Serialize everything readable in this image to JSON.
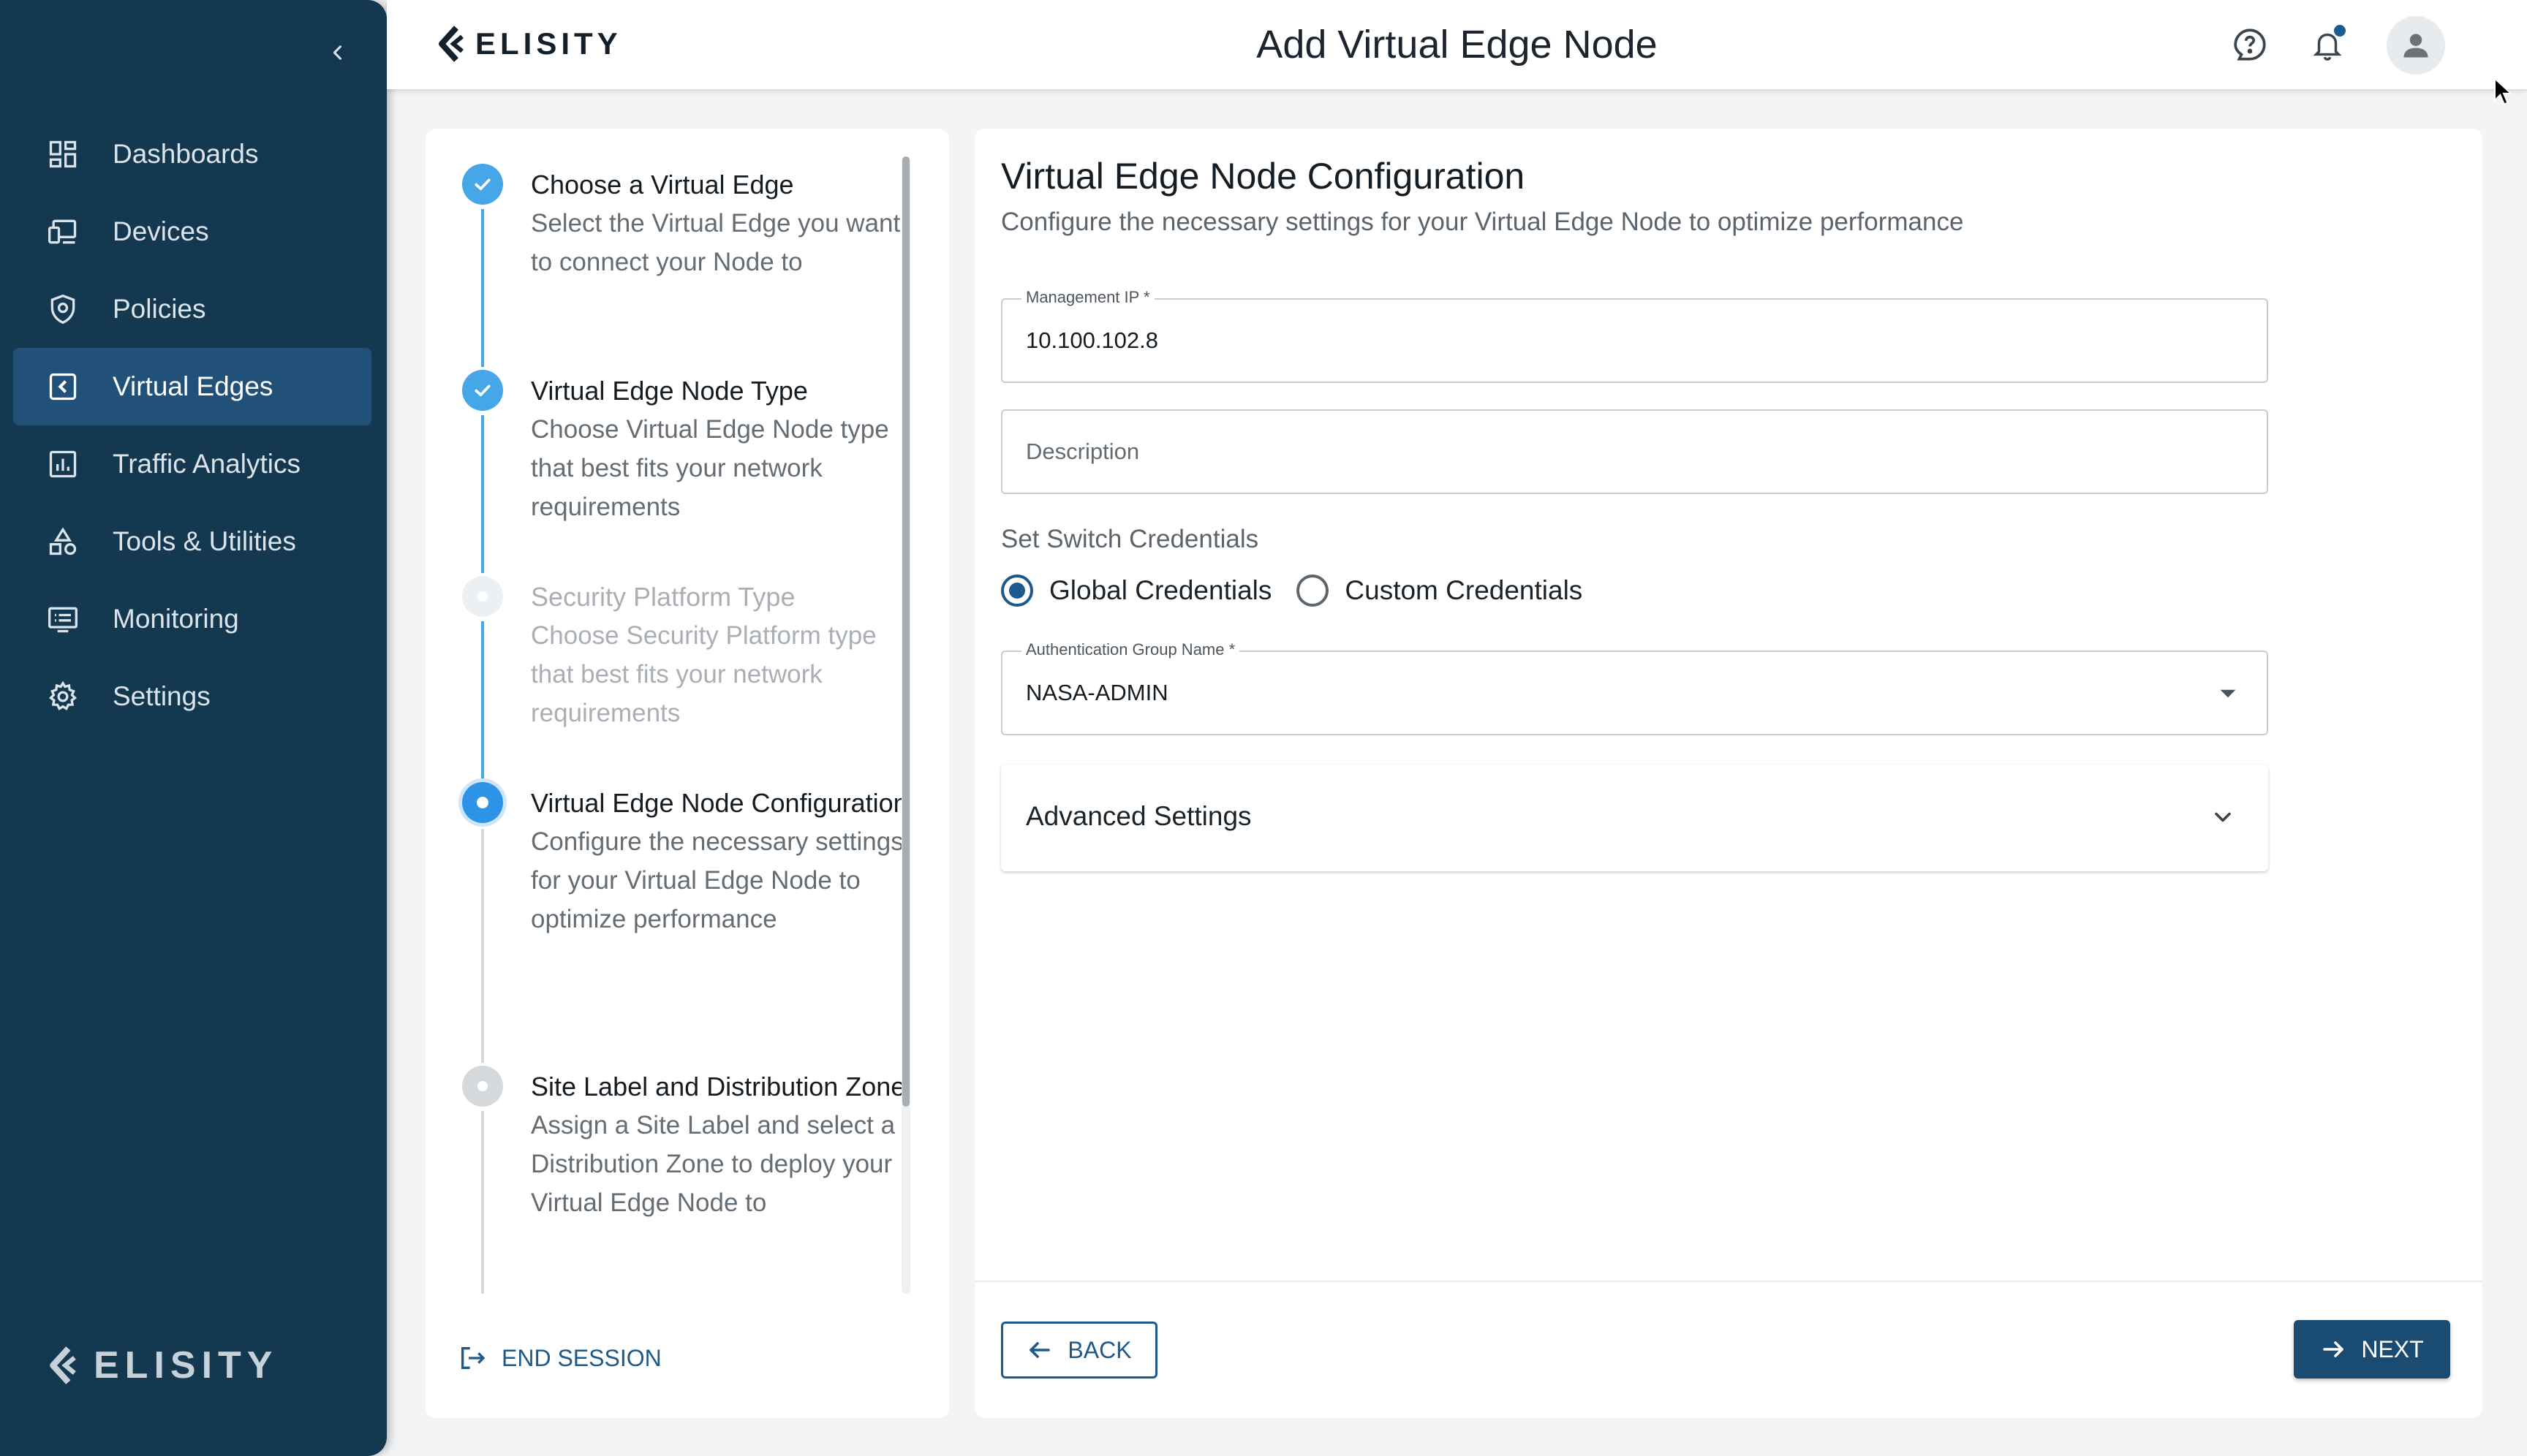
{
  "sidebar": {
    "items": [
      {
        "label": "Dashboards",
        "icon": "dashboard-icon"
      },
      {
        "label": "Devices",
        "icon": "devices-icon"
      },
      {
        "label": "Policies",
        "icon": "shield-icon"
      },
      {
        "label": "Virtual Edges",
        "icon": "virtual-edge-icon",
        "active": true
      },
      {
        "label": "Traffic Analytics",
        "icon": "analytics-icon"
      },
      {
        "label": "Tools & Utilities",
        "icon": "tools-icon"
      },
      {
        "label": "Monitoring",
        "icon": "monitor-icon"
      },
      {
        "label": "Settings",
        "icon": "gear-icon"
      }
    ],
    "logo_text": "ELISITY"
  },
  "header": {
    "brand": "ELISITY",
    "title": "Add Virtual Edge Node"
  },
  "stepper": {
    "steps": [
      {
        "title": "Choose a Virtual Edge",
        "description": "Select the Virtual Edge you want to connect your Node to",
        "state": "done"
      },
      {
        "title": "Virtual Edge Node Type",
        "description": "Choose Virtual Edge Node type that best fits your network requirements",
        "state": "done"
      },
      {
        "title": "Security Platform Type",
        "description": "Choose Security Platform type that best fits your network requirements",
        "state": "disabled"
      },
      {
        "title": "Virtual Edge Node Configuration",
        "description": "Configure the necessary settings for your Virtual Edge Node to optimize performance",
        "state": "active"
      },
      {
        "title": "Site Label and Distribution Zone",
        "description": "Assign a Site Label and select a Distribution Zone to deploy your Virtual Edge Node to",
        "state": "pending"
      }
    ],
    "end_session": "END SESSION"
  },
  "form": {
    "title": "Virtual Edge Node Configuration",
    "subtitle": "Configure the necessary settings for your Virtual Edge Node to optimize performance",
    "management_ip": {
      "label": "Management IP *",
      "value": "10.100.102.8"
    },
    "description": {
      "placeholder": "Description"
    },
    "credentials": {
      "label": "Set Switch Credentials",
      "options": [
        "Global Credentials",
        "Custom Credentials"
      ],
      "selected": "Global Credentials"
    },
    "auth_group": {
      "label": "Authentication Group Name *",
      "value": "NASA-ADMIN"
    },
    "advanced": {
      "label": "Advanced Settings"
    }
  },
  "footer": {
    "back": "BACK",
    "next": "NEXT"
  },
  "colors": {
    "sidebar_bg": "#14384f",
    "sidebar_active": "#215179",
    "accent": "#1d5a8b",
    "step_done": "#45a6e8"
  }
}
